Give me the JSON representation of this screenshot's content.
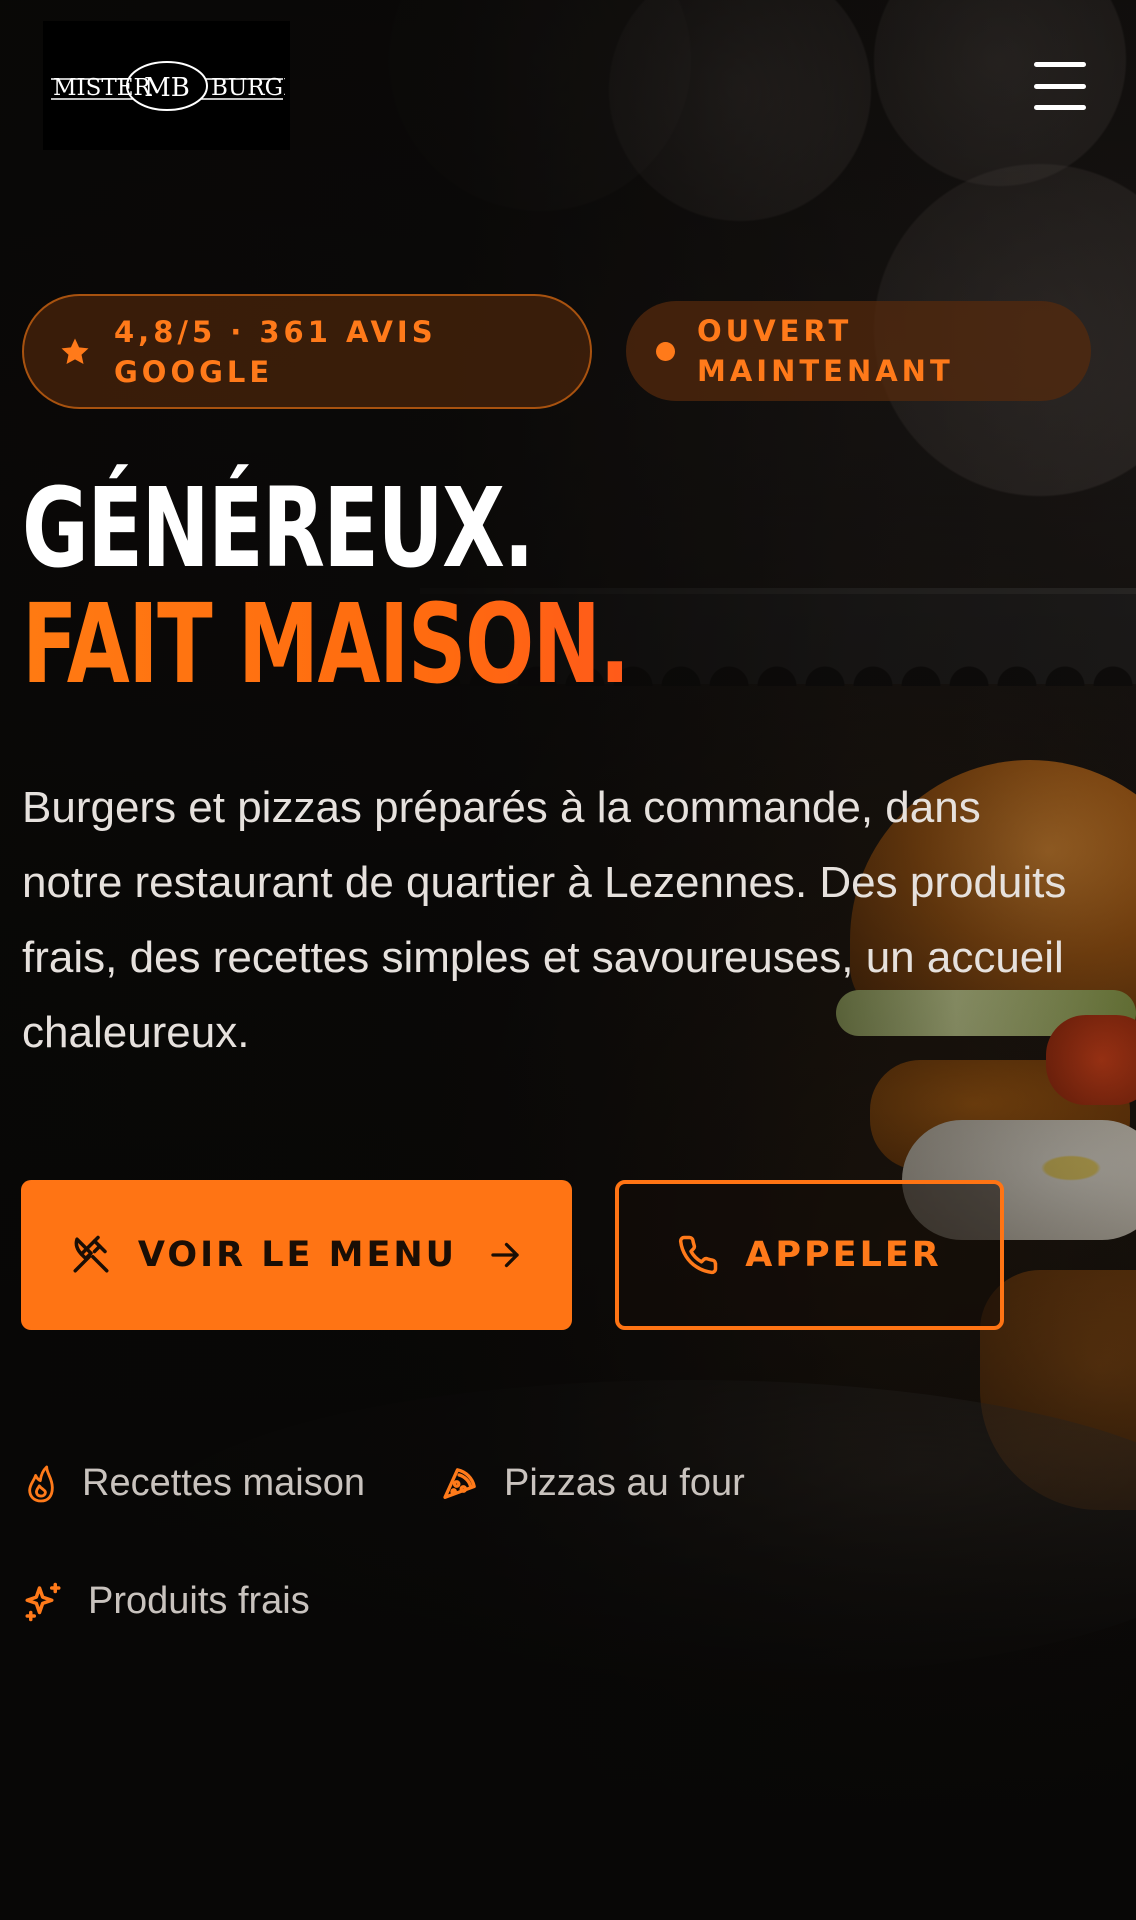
{
  "brand": {
    "logo_left": "MISTER",
    "logo_mid": "MB",
    "logo_right": "BURGER"
  },
  "nav": {
    "menu_icon": "hamburger-menu-icon"
  },
  "badges": {
    "rating_icon": "star-icon",
    "rating_line1": "4,8/5 · 361 AVIS",
    "rating_line2": "GOOGLE",
    "status_icon": "status-dot-icon",
    "status_line1": "OUVERT",
    "status_line2": "MAINTENANT"
  },
  "hero": {
    "headline_line1": "GÉNÉREUX.",
    "headline_line2": "FAIT MAISON.",
    "lead": "Burgers et pizzas préparés à la commande, dans notre restaurant de quartier à Lezennes. Des produits frais, des recettes simples et savoureuses, un accueil chaleureux."
  },
  "actions": {
    "menu_label": "VOIR LE MENU",
    "menu_icon": "utensils-crossed-icon",
    "menu_arrow": "arrow-right-icon",
    "call_label": "APPELER",
    "call_icon": "phone-icon"
  },
  "features": [
    {
      "icon": "flame-icon",
      "label": "Recettes maison"
    },
    {
      "icon": "pizza-icon",
      "label": "Pizzas au four"
    },
    {
      "icon": "sparkles-icon",
      "label": "Produits frais"
    }
  ],
  "colors": {
    "accent": "#ff7414",
    "background": "#0b0908",
    "text": "#ffffff",
    "muted_text": "#c9c3be"
  }
}
